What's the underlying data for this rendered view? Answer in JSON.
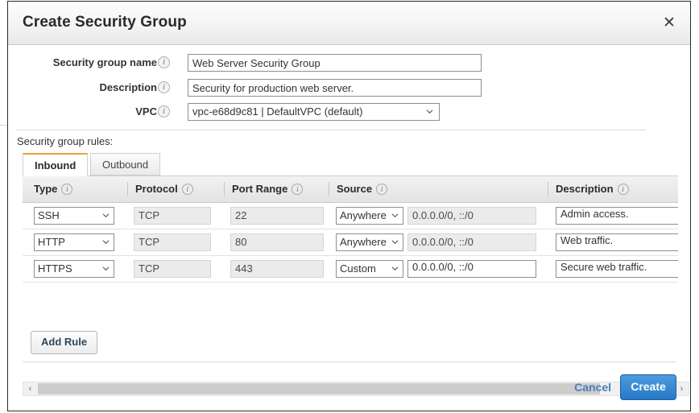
{
  "dialog": {
    "title": "Create Security Group",
    "close_label": "✕"
  },
  "form": {
    "fields": [
      {
        "label": "Security group name",
        "info": "i",
        "value": "Web Server Security Group",
        "placeholder": "",
        "type": "text"
      },
      {
        "label": "Description",
        "info": "i",
        "value": "Security for production web server.",
        "placeholder": "",
        "type": "text"
      },
      {
        "label": "VPC",
        "info": "i",
        "value": "vpc-e68d9c81 | DefaultVPC (default)",
        "type": "select"
      }
    ]
  },
  "rules": {
    "caption": "Security group rules:",
    "tabs": [
      {
        "label": "Inbound",
        "active": true
      },
      {
        "label": "Outbound",
        "active": false
      }
    ],
    "columns": [
      {
        "label": "Type",
        "info": "i"
      },
      {
        "label": "Protocol",
        "info": "i"
      },
      {
        "label": "Port Range",
        "info": "i"
      },
      {
        "label": "Source",
        "info": "i"
      },
      {
        "label": "Description",
        "info": "i"
      }
    ],
    "rows": [
      {
        "type": "SSH",
        "protocol": "TCP",
        "port_range": "22",
        "source_mode": "Anywhere",
        "source_cidr": "0.0.0.0/0, ::/0",
        "source_cidr_editable": false,
        "description": "Admin access."
      },
      {
        "type": "HTTP",
        "protocol": "TCP",
        "port_range": "80",
        "source_mode": "Anywhere",
        "source_cidr": "0.0.0.0/0, ::/0",
        "source_cidr_editable": false,
        "description": "Web traffic."
      },
      {
        "type": "HTTPS",
        "protocol": "TCP",
        "port_range": "443",
        "source_mode": "Custom",
        "source_cidr": "0.0.0.0/0, ::/0",
        "source_cidr_editable": true,
        "description": "Secure web traffic."
      }
    ],
    "add_rule_label": "Add Rule"
  },
  "scrollbar": {
    "left_arrow": "‹",
    "right_arrow": "›"
  },
  "footer": {
    "cancel_label": "Cancel",
    "create_label": "Create"
  },
  "colors": {
    "accent_tab": "#e8a33d",
    "primary_button": "#2579c6",
    "link": "#4a7ebb"
  }
}
